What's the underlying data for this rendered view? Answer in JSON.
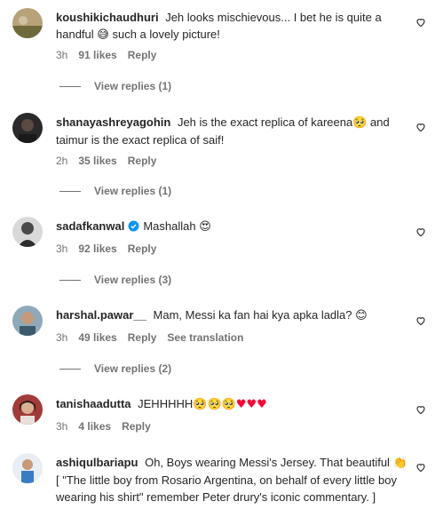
{
  "comments": [
    {
      "username": "koushikichaudhuri",
      "text": "Jeh looks mischievous... I bet he is quite a handful",
      "emoji_after": "😅",
      "text2": "such a lovely picture!",
      "time": "3h",
      "likes": "91 likes",
      "reply": "Reply",
      "view_replies": "View replies (1)"
    },
    {
      "username": "shanayashreyagohin",
      "text": "Jeh is the exact replica of kareena",
      "emoji_after": "🥺",
      "text2": "and taimur is the exact replica of saif!",
      "time": "2h",
      "likes": "35 likes",
      "reply": "Reply",
      "view_replies": "View replies (1)"
    },
    {
      "username": "sadafkanwal",
      "text": "Mashallah",
      "emoji_after": "😍",
      "time": "3h",
      "likes": "92 likes",
      "reply": "Reply",
      "view_replies": "View replies (3)"
    },
    {
      "username": "harshal.pawar__",
      "text": "Mam, Messi ka fan hai kya apka ladla?",
      "emoji_after": "😊",
      "time": "3h",
      "likes": "49 likes",
      "reply": "Reply",
      "see_translation": "See translation",
      "view_replies": "View replies (2)"
    },
    {
      "username": "tanishaadutta",
      "text": "JEHHHHH",
      "emoji_after": "🥺🥺🥺",
      "hearts": "♥♥♥",
      "time": "3h",
      "likes": "4 likes",
      "reply": "Reply"
    },
    {
      "username": "ashiqulbariapu",
      "text": "Oh, Boys wearing Messi's Jersey. That beautiful",
      "emoji_after": "👏",
      "text2": "[ \"The little boy from Rosario Argentina, on behalf of every little boy wearing his shirt\" remember Peter drury's iconic commentary. ]"
    }
  ],
  "icons": {
    "like": "heart-outline-icon",
    "verified": "verified-badge-icon"
  },
  "colors": {
    "text": "#262626",
    "meta": "#737373",
    "verified": "#0095f6",
    "heart_red": "#ff0033"
  }
}
